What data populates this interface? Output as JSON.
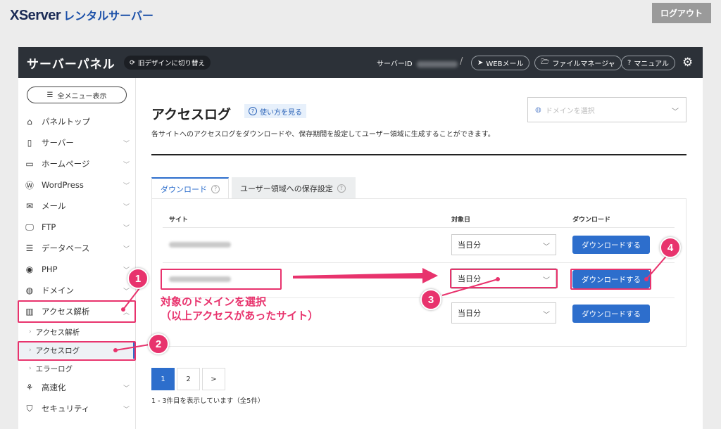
{
  "brand": {
    "logo_main": "XServer",
    "logo_sub": "レンタルサーバー"
  },
  "topbar": {
    "logout_label": "ログアウト"
  },
  "header": {
    "title": "サーバーパネル",
    "switch_label": "旧デザインに切り替え",
    "server_id_label": "サーバーID",
    "slash": "/",
    "web_mail_label": "WEBメール",
    "file_manager_label": "ファイルマネージャ",
    "manual_label": "マニュアル"
  },
  "sidebar": {
    "menu_all_label": "全メニュー表示",
    "items": [
      {
        "label": "パネルトップ",
        "icon": "home-icon"
      },
      {
        "label": "サーバー",
        "icon": "server-icon"
      },
      {
        "label": "ホームページ",
        "icon": "browser-icon"
      },
      {
        "label": "WordPress",
        "icon": "wordpress-icon"
      },
      {
        "label": "メール",
        "icon": "mail-icon"
      },
      {
        "label": "FTP",
        "icon": "monitor-icon"
      },
      {
        "label": "データベース",
        "icon": "database-icon"
      },
      {
        "label": "PHP",
        "icon": "php-icon"
      },
      {
        "label": "ドメイン",
        "icon": "globe-icon"
      },
      {
        "label": "アクセス解析",
        "icon": "chart-icon"
      },
      {
        "label": "高速化",
        "icon": "speed-icon"
      },
      {
        "label": "セキュリティ",
        "icon": "shield-icon"
      }
    ],
    "sub_items": [
      {
        "label": "アクセス解析"
      },
      {
        "label": "アクセスログ"
      },
      {
        "label": "エラーログ"
      }
    ]
  },
  "main": {
    "title": "アクセスログ",
    "help_label": "使い方を見る",
    "description": "各サイトへのアクセスログをダウンロードや、保存期間を設定してユーザー領域に生成することができます。",
    "domain_select_placeholder": "ドメインを選択",
    "tabs": [
      {
        "label": "ダウンロード"
      },
      {
        "label": "ユーザー領域への保存設定"
      }
    ],
    "table": {
      "headers": {
        "site": "サイト",
        "date": "対象日",
        "download": "ダウンロード"
      },
      "rows": [
        {
          "date": "当日分",
          "button": "ダウンロードする"
        },
        {
          "date": "当日分",
          "button": "ダウンロードする"
        },
        {
          "date": "当日分",
          "button": "ダウンロードする"
        }
      ]
    },
    "pagination": {
      "pages": [
        "1",
        "2",
        ">"
      ],
      "current": "1"
    },
    "count_text": "1 - 3件目を表示しています（全5件）"
  },
  "annotation": {
    "line1": "対象のドメインを選択",
    "line2": "（以上アクセスがあったサイト）",
    "badges": [
      "1",
      "2",
      "3",
      "4"
    ],
    "accent_color": "#e8336d"
  },
  "colors": {
    "primary": "#2d6ecc",
    "header_bg": "#2c3138",
    "highlight": "#e8336d"
  }
}
